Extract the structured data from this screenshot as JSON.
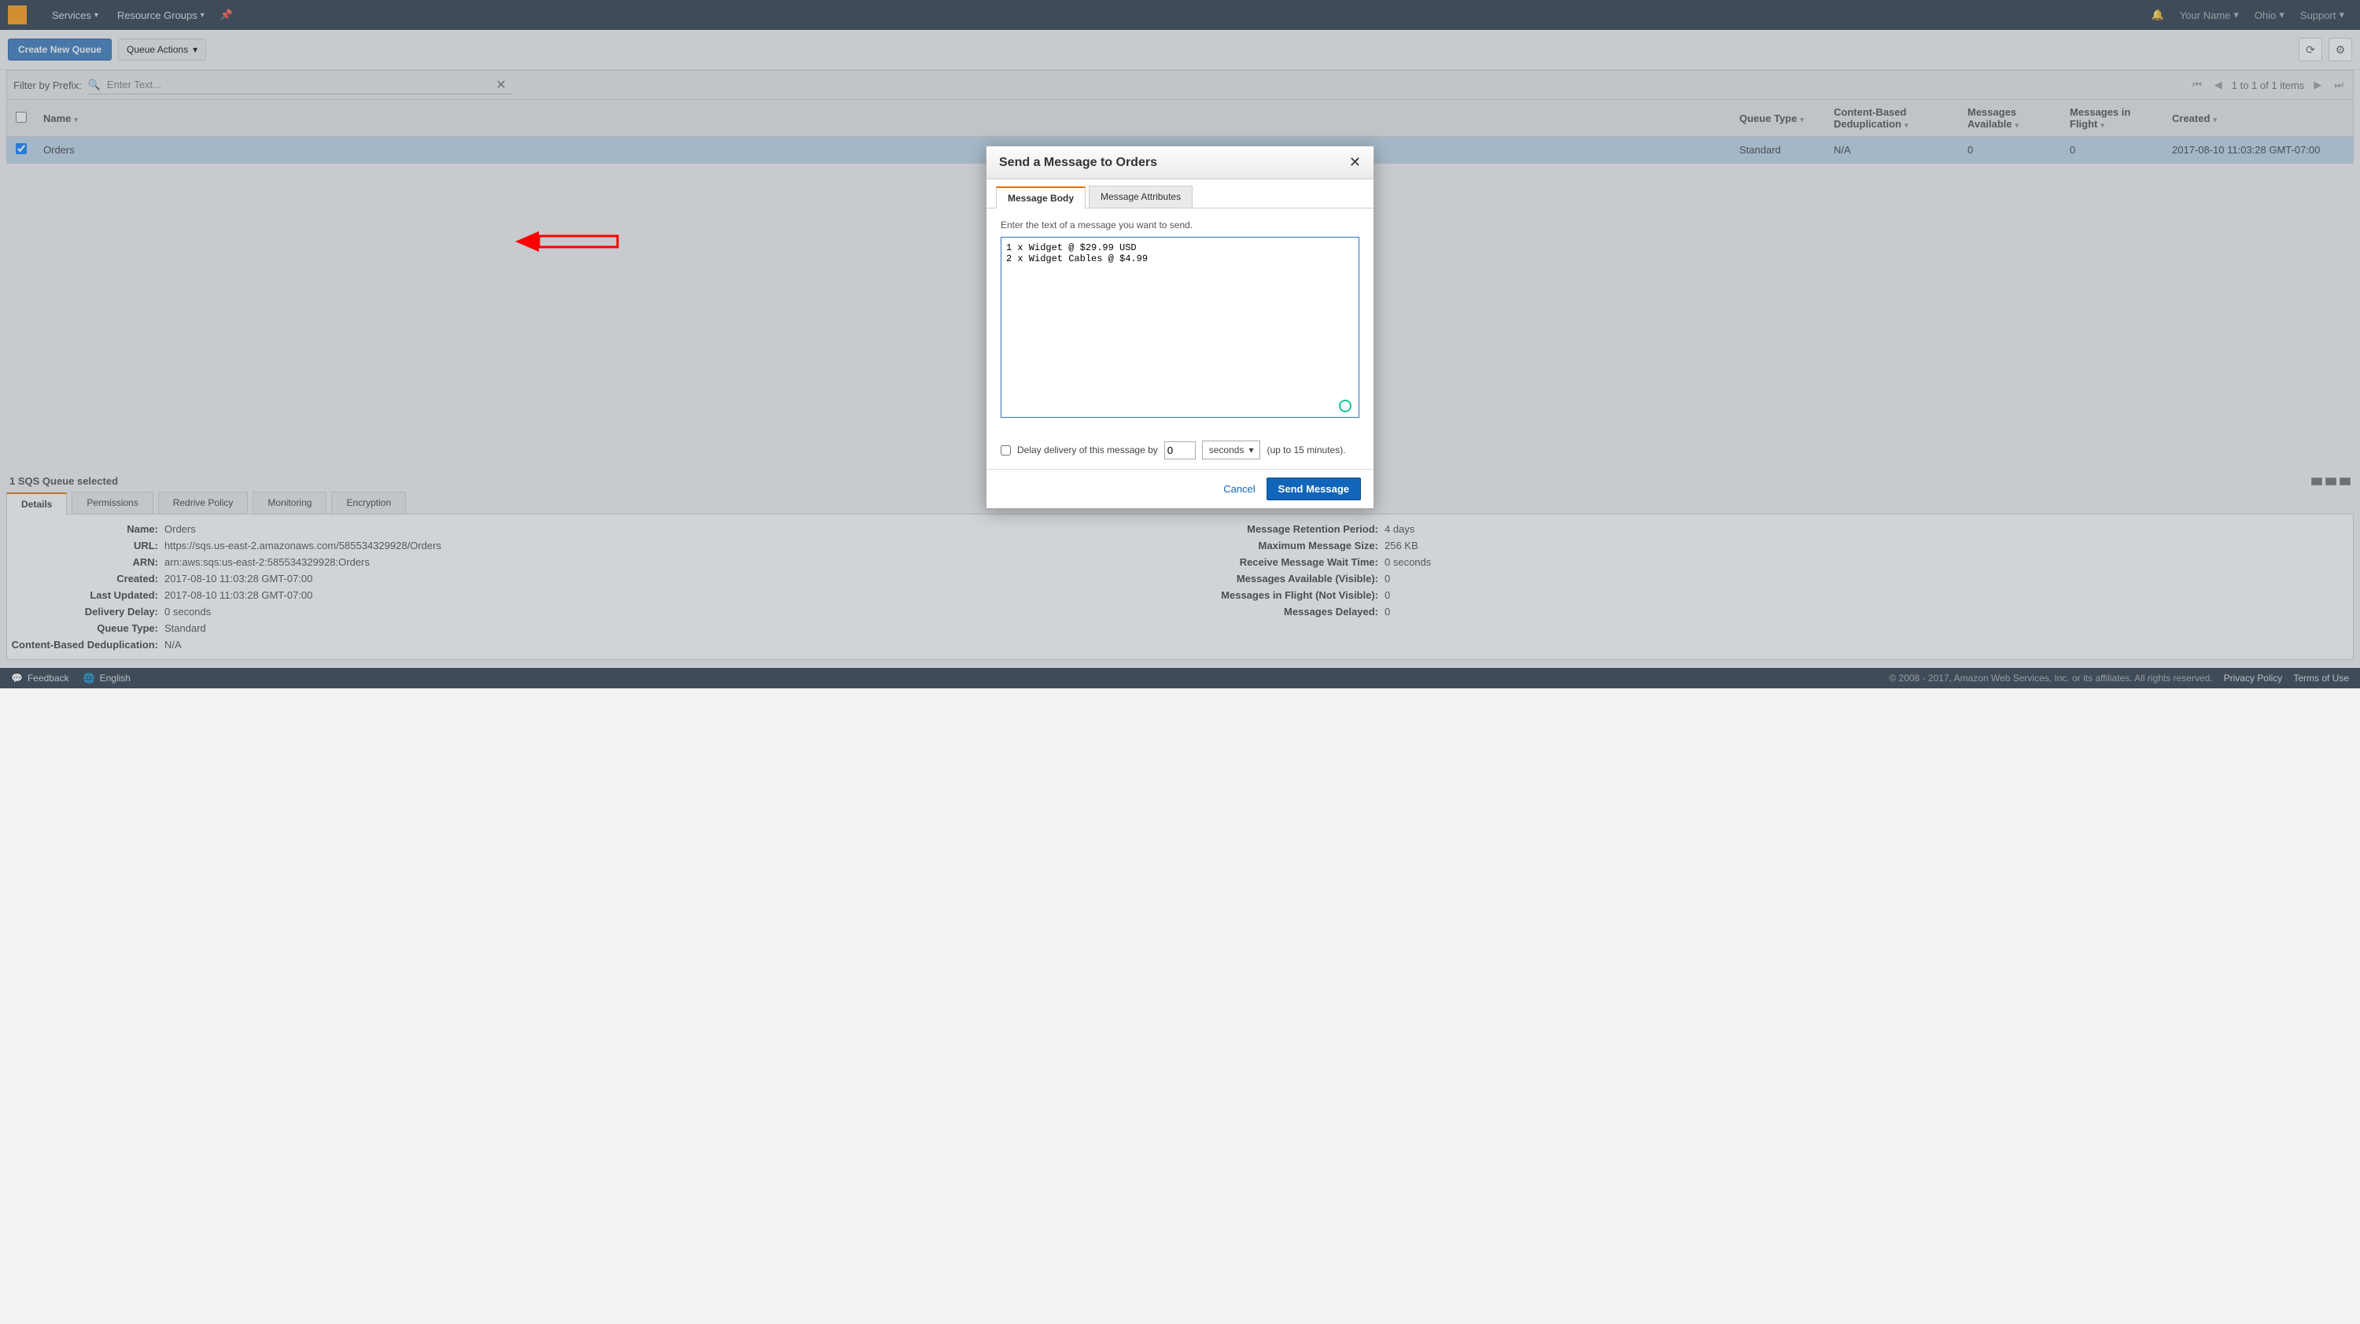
{
  "nav": {
    "services": "Services",
    "resource_groups": "Resource Groups",
    "your_name": "Your Name",
    "region": "Ohio",
    "support": "Support"
  },
  "toolbar": {
    "create": "Create New Queue",
    "actions": "Queue Actions"
  },
  "filter": {
    "label": "Filter by Prefix:",
    "placeholder": "Enter Text...",
    "pager_text": "1 to 1 of 1 items"
  },
  "table": {
    "headers": {
      "name": "Name",
      "queue_type": "Queue Type",
      "dedup": "Content-Based Deduplication",
      "avail": "Messages Available",
      "flight": "Messages in Flight",
      "created": "Created"
    },
    "row": {
      "name": "Orders",
      "queue_type": "Standard",
      "dedup": "N/A",
      "avail": "0",
      "flight": "0",
      "created": "2017-08-10 11:03:28 GMT-07:00"
    }
  },
  "details": {
    "selected": "1 SQS Queue selected",
    "tabs": {
      "details": "Details",
      "permissions": "Permissions",
      "redrive": "Redrive Policy",
      "monitoring": "Monitoring",
      "encryption": "Encryption"
    },
    "left": {
      "name_k": "Name:",
      "name_v": "Orders",
      "url_k": "URL:",
      "url_v": "https://sqs.us-east-2.amazonaws.com/585534329928/Orders",
      "arn_k": "ARN:",
      "arn_v": "arn:aws:sqs:us-east-2:585534329928:Orders",
      "created_k": "Created:",
      "created_v": "2017-08-10 11:03:28 GMT-07:00",
      "updated_k": "Last Updated:",
      "updated_v": "2017-08-10 11:03:28 GMT-07:00",
      "delay_k": "Delivery Delay:",
      "delay_v": "0 seconds",
      "qtype_k": "Queue Type:",
      "qtype_v": "Standard",
      "dedup_k": "Content-Based Deduplication:",
      "dedup_v": "N/A"
    },
    "right": {
      "retention_k": "Message Retention Period:",
      "retention_v": "4 days",
      "maxsize_k": "Maximum Message Size:",
      "maxsize_v": "256 KB",
      "waittime_k": "Receive Message Wait Time:",
      "waittime_v": "0 seconds",
      "avail_k": "Messages Available (Visible):",
      "avail_v": "0",
      "flight_k": "Messages in Flight (Not Visible):",
      "flight_v": "0",
      "delayed_k": "Messages Delayed:",
      "delayed_v": "0"
    }
  },
  "footer": {
    "feedback": "Feedback",
    "english": "English",
    "copyright": "© 2008 - 2017, Amazon Web Services, Inc. or its affiliates. All rights reserved.",
    "privacy": "Privacy Policy",
    "terms": "Terms of Use"
  },
  "modal": {
    "title": "Send a Message to Orders",
    "tab_body": "Message Body",
    "tab_attrs": "Message Attributes",
    "inst": "Enter the text of a message you want to send.",
    "body_value": "1 x Widget @ $29.99 USD\n2 x Widget Cables @ $4.99",
    "delay_label": "Delay delivery of this message by",
    "delay_value": "0",
    "delay_unit": "seconds",
    "delay_hint": "(up to 15 minutes).",
    "cancel": "Cancel",
    "send": "Send Message"
  }
}
